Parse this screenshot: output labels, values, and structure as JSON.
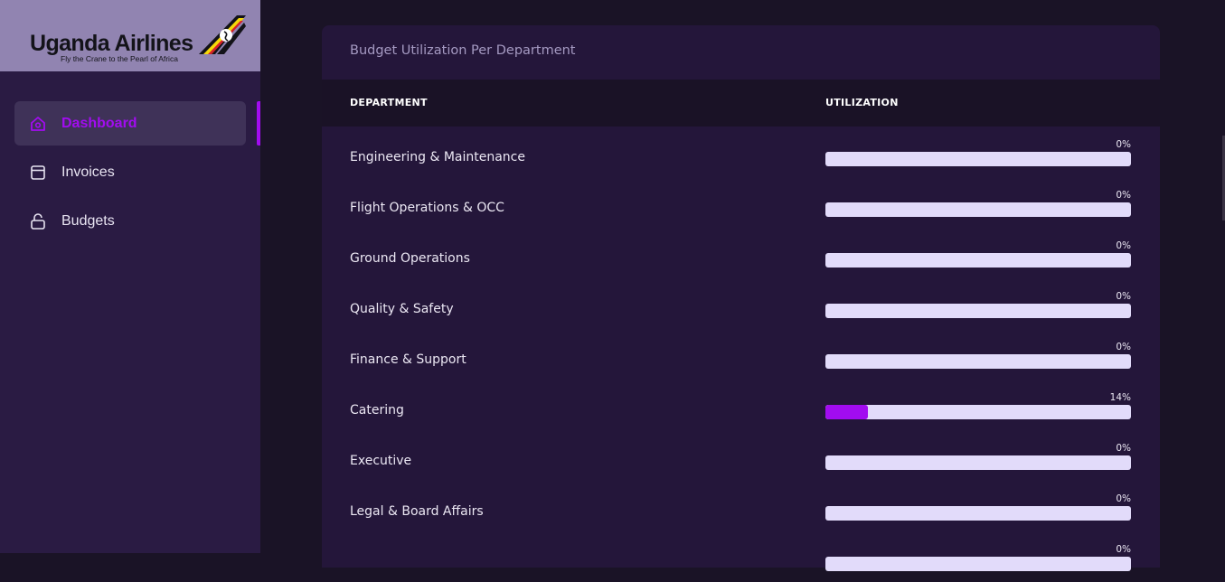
{
  "brand": {
    "name": "Uganda Airlines",
    "tagline": "Fly the Crane to the Pearl of Africa",
    "colors": {
      "black": "#131319",
      "yellow": "#f5d90a",
      "red": "#d4202a"
    }
  },
  "sidebar": {
    "items": [
      {
        "label": "Dashboard",
        "icon": "home-icon",
        "active": true
      },
      {
        "label": "Invoices",
        "icon": "invoice-icon",
        "active": false
      },
      {
        "label": "Budgets",
        "icon": "unlock-icon",
        "active": false
      }
    ]
  },
  "card": {
    "title": "Budget Utilization Per Department",
    "columns": [
      "DEPARTMENT",
      "UTILIZATION"
    ],
    "rows": [
      {
        "department": "Engineering & Maintenance",
        "utilization_label": "0%",
        "utilization": 0
      },
      {
        "department": "Flight Operations & OCC",
        "utilization_label": "0%",
        "utilization": 0
      },
      {
        "department": "Ground Operations",
        "utilization_label": "0%",
        "utilization": 0
      },
      {
        "department": "Quality & Safety",
        "utilization_label": "0%",
        "utilization": 0
      },
      {
        "department": "Finance & Support",
        "utilization_label": "0%",
        "utilization": 0
      },
      {
        "department": "Catering",
        "utilization_label": "14%",
        "utilization": 14
      },
      {
        "department": "Executive",
        "utilization_label": "0%",
        "utilization": 0
      },
      {
        "department": "Legal & Board Affairs",
        "utilization_label": "0%",
        "utilization": 0
      },
      {
        "department": "",
        "utilization_label": "0%",
        "utilization": 0
      }
    ]
  },
  "colors": {
    "accent": "#a20cf0",
    "bar_track": "#e2dbfa",
    "sidebar_bg": "#2a1b43",
    "page_bg": "#1a1326",
    "card_bg": "#24163a"
  }
}
